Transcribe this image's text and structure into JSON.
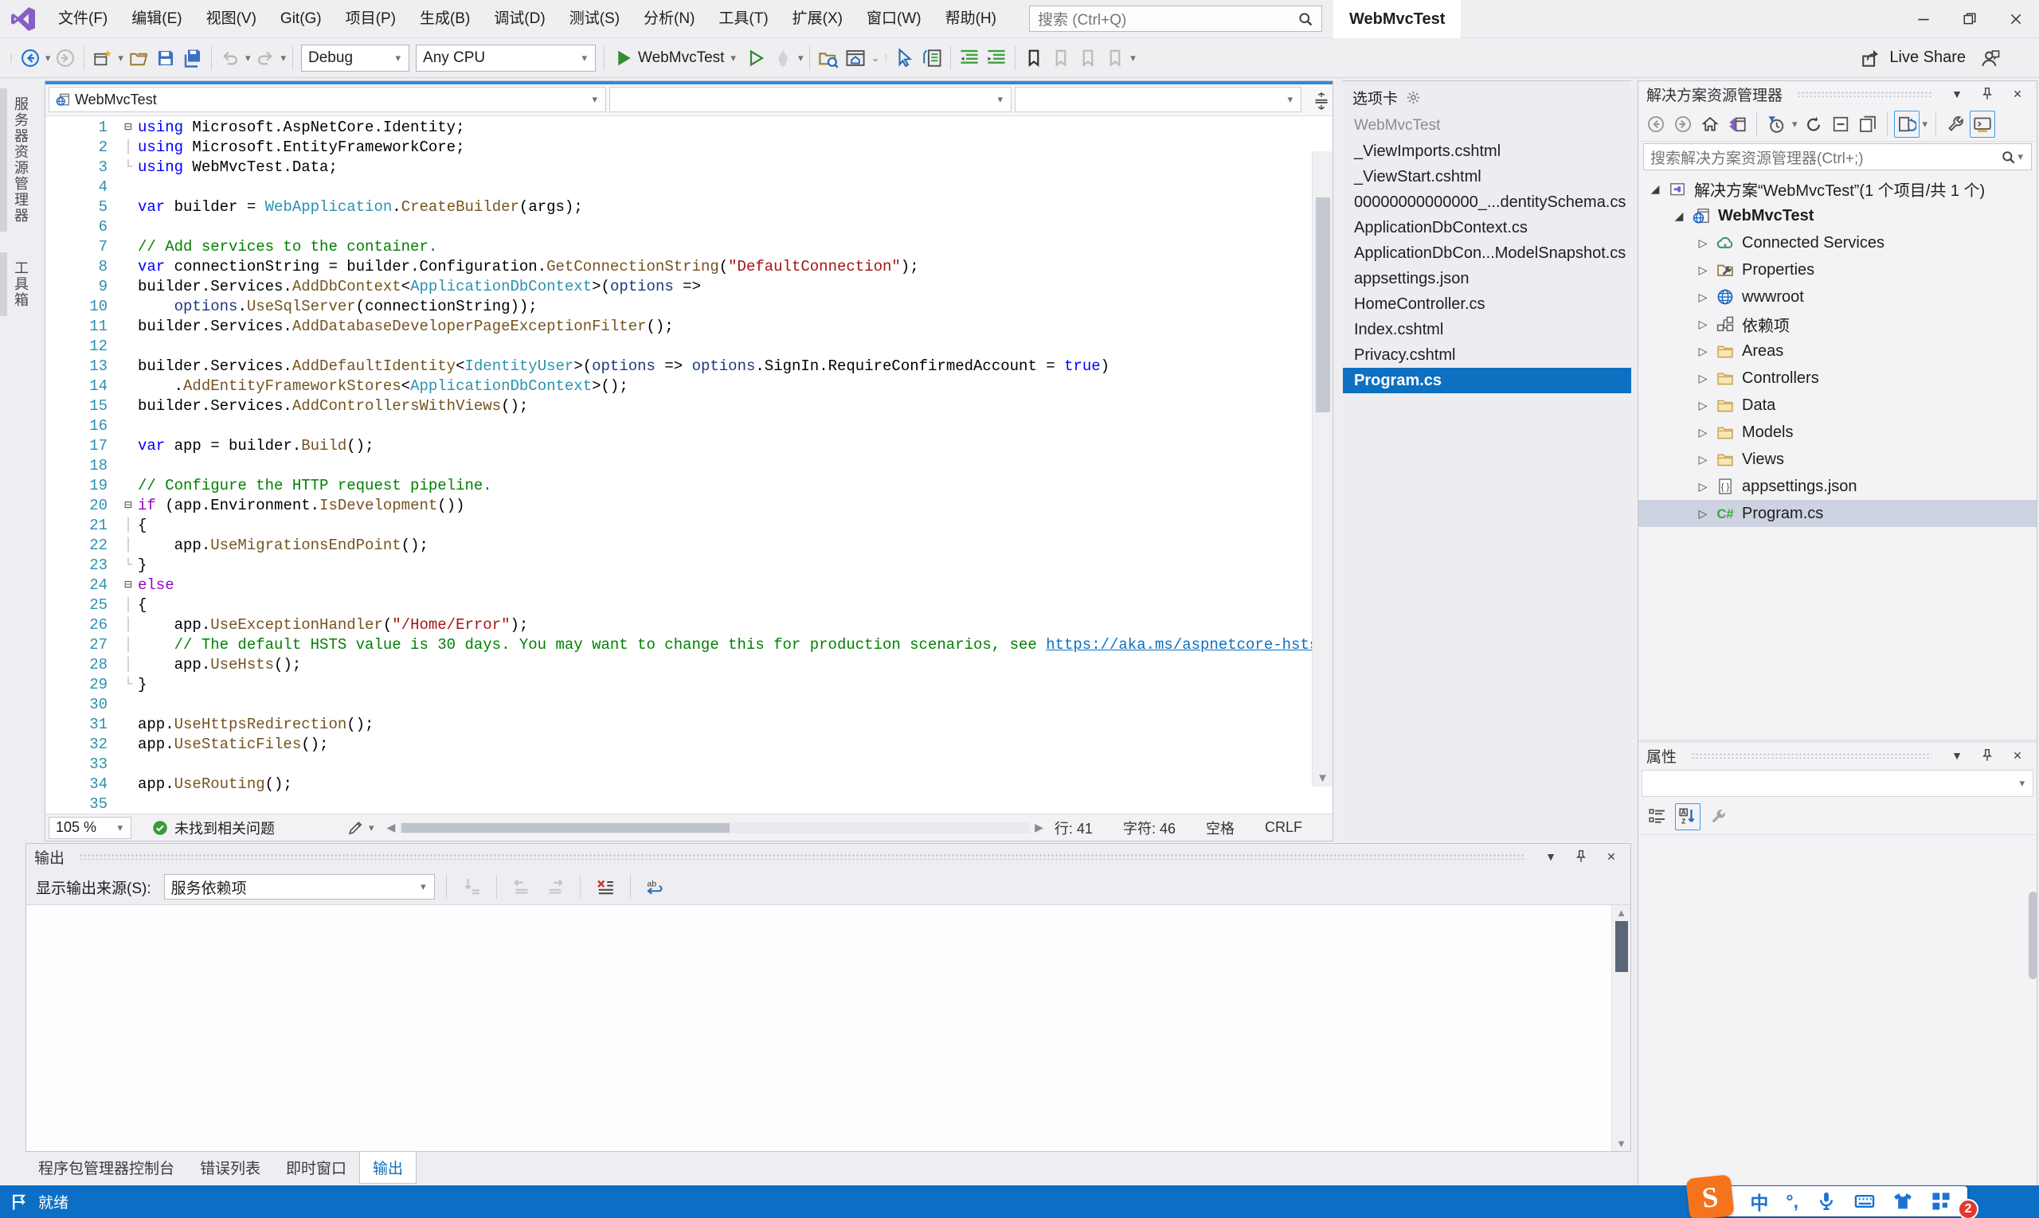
{
  "colors": {
    "accent_blue": "#0E70C0",
    "statusbar_blue": "#0C6FC5",
    "editor_active_indicator": "#2E8AE0",
    "run_green": "#388A34",
    "vs_logo_purple": "#865FC5",
    "sogou_orange": "#F4731C",
    "selected_tree_row": "#CDD3E0",
    "line_number": "#2B91AF",
    "syntax": {
      "keyword": "#0000FF",
      "control": "#8F08C4",
      "type": "#2B91AF",
      "method": "#74531F",
      "string": "#A31515",
      "comment": "#008000",
      "parameter": "#1F377F",
      "link": "#0E70C0",
      "plain": "#000000"
    }
  },
  "icons": {
    "search": "magnifier",
    "settings": "gear",
    "run": "play-triangle",
    "save": "floppy",
    "hot_reload": "flame",
    "pin": "pin",
    "close": "x",
    "bookmark": "flag-ribbon"
  },
  "titlebar": {
    "menus": [
      "文件(F)",
      "编辑(E)",
      "视图(V)",
      "Git(G)",
      "项目(P)",
      "生成(B)",
      "调试(D)",
      "测试(S)",
      "分析(N)",
      "工具(T)",
      "扩展(X)",
      "窗口(W)",
      "帮助(H)"
    ],
    "search_placeholder": "搜索 (Ctrl+Q)",
    "window_title": "WebMvcTest"
  },
  "toolbar": {
    "debug_config": "Debug",
    "platform": "Any CPU",
    "run_target": "WebMvcTest",
    "live_share_label": "Live Share"
  },
  "left_strip": {
    "tabs": [
      "服务器资源管理器",
      "工具箱"
    ]
  },
  "editor": {
    "nav_project": "WebMvcTest",
    "status": {
      "zoom": "105 %",
      "health": "未找到相关问题",
      "line": "行: 41",
      "char": "字符: 46",
      "space": "空格",
      "eol": "CRLF"
    },
    "lines": [
      {
        "n": 1,
        "f": "o",
        "s": [
          [
            "kw",
            "using"
          ],
          [
            "pl",
            " Microsoft.AspNetCore.Identity;"
          ]
        ]
      },
      {
        "n": 2,
        "f": "m",
        "s": [
          [
            "kw",
            "using"
          ],
          [
            "pl",
            " Microsoft.EntityFrameworkCore;"
          ]
        ]
      },
      {
        "n": 3,
        "f": "e",
        "s": [
          [
            "kw",
            "using"
          ],
          [
            "pl",
            " WebMvcTest.Data;"
          ]
        ]
      },
      {
        "n": 4,
        "s": []
      },
      {
        "n": 5,
        "s": [
          [
            "kw",
            "var"
          ],
          [
            "pl",
            " builder = "
          ],
          [
            "ty",
            "WebApplication"
          ],
          [
            "pl",
            "."
          ],
          [
            "me",
            "CreateBuilder"
          ],
          [
            "pl",
            "(args);"
          ]
        ]
      },
      {
        "n": 6,
        "s": []
      },
      {
        "n": 7,
        "s": [
          [
            "co",
            "// Add services to the container."
          ]
        ]
      },
      {
        "n": 8,
        "s": [
          [
            "kw",
            "var"
          ],
          [
            "pl",
            " connectionString = builder.Configuration."
          ],
          [
            "me",
            "GetConnectionString"
          ],
          [
            "pl",
            "("
          ],
          [
            "st",
            "\"DefaultConnection\""
          ],
          [
            "pl",
            ");"
          ]
        ]
      },
      {
        "n": 9,
        "s": [
          [
            "pl",
            "builder.Services."
          ],
          [
            "me",
            "AddDbContext"
          ],
          [
            "pl",
            "<"
          ],
          [
            "ty",
            "ApplicationDbContext"
          ],
          [
            "pl",
            ">("
          ],
          [
            "pa",
            "options"
          ],
          [
            "pl",
            " =>"
          ]
        ]
      },
      {
        "n": 10,
        "s": [
          [
            "pl",
            "    "
          ],
          [
            "pa",
            "options"
          ],
          [
            "pl",
            "."
          ],
          [
            "me",
            "UseSqlServer"
          ],
          [
            "pl",
            "(connectionString));"
          ]
        ]
      },
      {
        "n": 11,
        "s": [
          [
            "pl",
            "builder.Services."
          ],
          [
            "me",
            "AddDatabaseDeveloperPageExceptionFilter"
          ],
          [
            "pl",
            "();"
          ]
        ]
      },
      {
        "n": 12,
        "s": []
      },
      {
        "n": 13,
        "s": [
          [
            "pl",
            "builder.Services."
          ],
          [
            "me",
            "AddDefaultIdentity"
          ],
          [
            "pl",
            "<"
          ],
          [
            "ty",
            "IdentityUser"
          ],
          [
            "pl",
            ">("
          ],
          [
            "pa",
            "options"
          ],
          [
            "pl",
            " => "
          ],
          [
            "pa",
            "options"
          ],
          [
            "pl",
            ".SignIn.RequireConfirmedAccount = "
          ],
          [
            "kw",
            "true"
          ],
          [
            "pl",
            ")"
          ]
        ]
      },
      {
        "n": 14,
        "s": [
          [
            "pl",
            "    ."
          ],
          [
            "me",
            "AddEntityFrameworkStores"
          ],
          [
            "pl",
            "<"
          ],
          [
            "ty",
            "ApplicationDbContext"
          ],
          [
            "pl",
            ">();"
          ]
        ]
      },
      {
        "n": 15,
        "s": [
          [
            "pl",
            "builder.Services."
          ],
          [
            "me",
            "AddControllersWithViews"
          ],
          [
            "pl",
            "();"
          ]
        ]
      },
      {
        "n": 16,
        "s": []
      },
      {
        "n": 17,
        "s": [
          [
            "kw",
            "var"
          ],
          [
            "pl",
            " app = builder."
          ],
          [
            "me",
            "Build"
          ],
          [
            "pl",
            "();"
          ]
        ]
      },
      {
        "n": 18,
        "s": []
      },
      {
        "n": 19,
        "s": [
          [
            "co",
            "// Configure the HTTP request pipeline."
          ]
        ]
      },
      {
        "n": 20,
        "f": "o",
        "s": [
          [
            "ct",
            "if"
          ],
          [
            "pl",
            " (app.Environment."
          ],
          [
            "me",
            "IsDevelopment"
          ],
          [
            "pl",
            "())"
          ]
        ]
      },
      {
        "n": 21,
        "f": "m",
        "s": [
          [
            "pl",
            "{"
          ]
        ]
      },
      {
        "n": 22,
        "f": "m",
        "s": [
          [
            "pl",
            "    app."
          ],
          [
            "me",
            "UseMigrationsEndPoint"
          ],
          [
            "pl",
            "();"
          ]
        ]
      },
      {
        "n": 23,
        "f": "e",
        "s": [
          [
            "pl",
            "}"
          ]
        ]
      },
      {
        "n": 24,
        "f": "o",
        "s": [
          [
            "ct",
            "else"
          ]
        ]
      },
      {
        "n": 25,
        "f": "m",
        "s": [
          [
            "pl",
            "{"
          ]
        ]
      },
      {
        "n": 26,
        "f": "m",
        "s": [
          [
            "pl",
            "    app."
          ],
          [
            "me",
            "UseExceptionHandler"
          ],
          [
            "pl",
            "("
          ],
          [
            "st",
            "\"/Home/Error\""
          ],
          [
            "pl",
            ");"
          ]
        ]
      },
      {
        "n": 27,
        "f": "m",
        "s": [
          [
            "pl",
            "    "
          ],
          [
            "co",
            "// The default HSTS value is 30 days. You may want to change this for production scenarios, see "
          ],
          [
            "ln",
            "https://aka.ms/aspnetcore-hsts"
          ],
          [
            "co",
            "."
          ]
        ]
      },
      {
        "n": 28,
        "f": "m",
        "s": [
          [
            "pl",
            "    app."
          ],
          [
            "me",
            "UseHsts"
          ],
          [
            "pl",
            "();"
          ]
        ]
      },
      {
        "n": 29,
        "f": "e",
        "s": [
          [
            "pl",
            "}"
          ]
        ]
      },
      {
        "n": 30,
        "s": []
      },
      {
        "n": 31,
        "s": [
          [
            "pl",
            "app."
          ],
          [
            "me",
            "UseHttpsRedirection"
          ],
          [
            "pl",
            "();"
          ]
        ]
      },
      {
        "n": 32,
        "s": [
          [
            "pl",
            "app."
          ],
          [
            "me",
            "UseStaticFiles"
          ],
          [
            "pl",
            "();"
          ]
        ]
      },
      {
        "n": 33,
        "s": []
      },
      {
        "n": 34,
        "s": [
          [
            "pl",
            "app."
          ],
          [
            "me",
            "UseRouting"
          ],
          [
            "pl",
            "();"
          ]
        ]
      },
      {
        "n": 35,
        "s": []
      }
    ]
  },
  "tabs_panel": {
    "title": "选项卡",
    "group": "WebMvcTest",
    "items": [
      "_ViewImports.cshtml",
      "_ViewStart.cshtml",
      "00000000000000_...dentitySchema.cs",
      "ApplicationDbContext.cs",
      "ApplicationDbCon...ModelSnapshot.cs",
      "appsettings.json",
      "HomeController.cs",
      "Index.cshtml",
      "Privacy.cshtml",
      "Program.cs"
    ],
    "selected": "Program.cs"
  },
  "solution_explorer": {
    "title": "解决方案资源管理器",
    "search_placeholder": "搜索解决方案资源管理器(Ctrl+;)",
    "nodes": [
      {
        "label": "解决方案“WebMvcTest”(1 个项目/共 1 个)",
        "icon": "solution",
        "arrow": "exp",
        "indent": 0
      },
      {
        "label": "WebMvcTest",
        "icon": "project",
        "arrow": "exp",
        "indent": 1,
        "bold": true
      },
      {
        "label": "Connected Services",
        "icon": "cloud",
        "arrow": "col",
        "indent": 2
      },
      {
        "label": "Properties",
        "icon": "props",
        "arrow": "col",
        "indent": 2
      },
      {
        "label": "wwwroot",
        "icon": "globe",
        "arrow": "col",
        "indent": 2
      },
      {
        "label": "依赖项",
        "icon": "deps",
        "arrow": "col",
        "indent": 2
      },
      {
        "label": "Areas",
        "icon": "folder",
        "arrow": "col",
        "indent": 2
      },
      {
        "label": "Controllers",
        "icon": "folder",
        "arrow": "col",
        "indent": 2
      },
      {
        "label": "Data",
        "icon": "folder",
        "arrow": "col",
        "indent": 2
      },
      {
        "label": "Models",
        "icon": "folder",
        "arrow": "col",
        "indent": 2
      },
      {
        "label": "Views",
        "icon": "folder",
        "arrow": "col",
        "indent": 2
      },
      {
        "label": "appsettings.json",
        "icon": "json",
        "arrow": "col",
        "indent": 2
      },
      {
        "label": "Program.cs",
        "icon": "csharp",
        "arrow": "col",
        "indent": 2,
        "selected": true
      }
    ]
  },
  "properties_panel": {
    "title": "属性"
  },
  "output_panel": {
    "title": "输出",
    "source_label": "显示输出来源(S):",
    "source_value": "服务依赖项",
    "tabs": [
      "程序包管理器控制台",
      "错误列表",
      "即时窗口",
      "输出"
    ],
    "active_tab": "输出"
  },
  "statusbar": {
    "ready": "就绪"
  },
  "ime": {
    "mode": "中",
    "punct": "°,",
    "badge": "2"
  }
}
